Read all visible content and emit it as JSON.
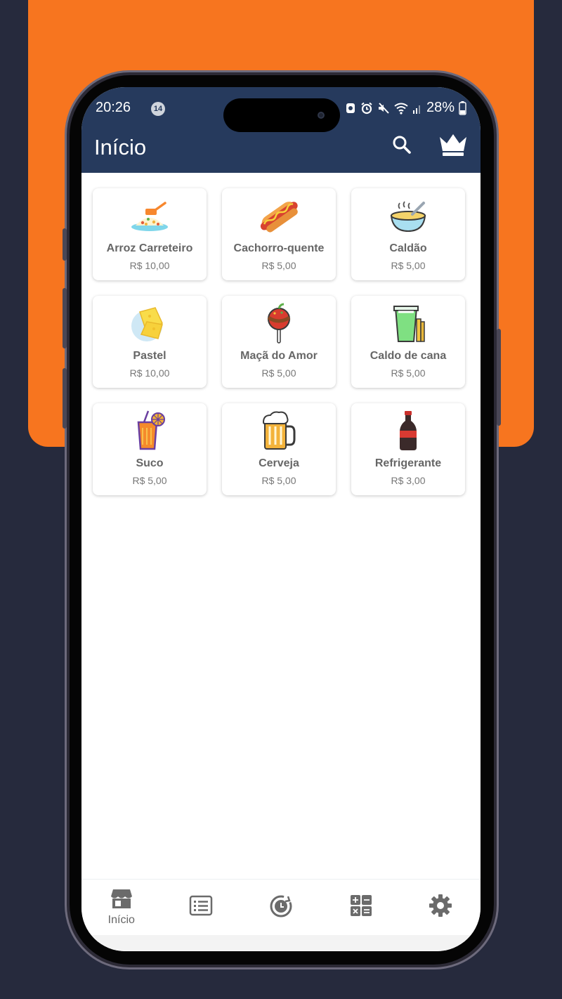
{
  "status_bar": {
    "time": "20:26",
    "notification_count": "14",
    "battery": "28%"
  },
  "app_bar": {
    "title": "Início"
  },
  "products": [
    {
      "name": "Arroz Carreteiro",
      "price": "R$ 10,00",
      "icon": "rice-dish-icon"
    },
    {
      "name": "Cachorro-quente",
      "price": "R$ 5,00",
      "icon": "hot-dog-icon"
    },
    {
      "name": "Caldão",
      "price": "R$ 5,00",
      "icon": "soup-bowl-icon"
    },
    {
      "name": "Pastel",
      "price": "R$ 10,00",
      "icon": "pastel-icon"
    },
    {
      "name": "Maçã do Amor",
      "price": "R$ 5,00",
      "icon": "candy-apple-icon"
    },
    {
      "name": "Caldo de cana",
      "price": "R$ 5,00",
      "icon": "sugarcane-juice-icon"
    },
    {
      "name": "Suco",
      "price": "R$ 5,00",
      "icon": "juice-icon"
    },
    {
      "name": "Cerveja",
      "price": "R$ 5,00",
      "icon": "beer-mug-icon"
    },
    {
      "name": "Refrigerante",
      "price": "R$ 3,00",
      "icon": "soda-bottle-icon"
    }
  ],
  "bottom_nav": [
    {
      "label": "Início",
      "icon": "store-icon",
      "active": true
    },
    {
      "label": "",
      "icon": "list-icon",
      "active": false
    },
    {
      "label": "",
      "icon": "history-icon",
      "active": false
    },
    {
      "label": "",
      "icon": "calculator-icon",
      "active": false
    },
    {
      "label": "",
      "icon": "gear-icon",
      "active": false
    }
  ],
  "colors": {
    "background": "#262a3d",
    "accent": "#f7751f",
    "app_bar": "#263a5d",
    "nav_icon": "#6b6b6b"
  }
}
